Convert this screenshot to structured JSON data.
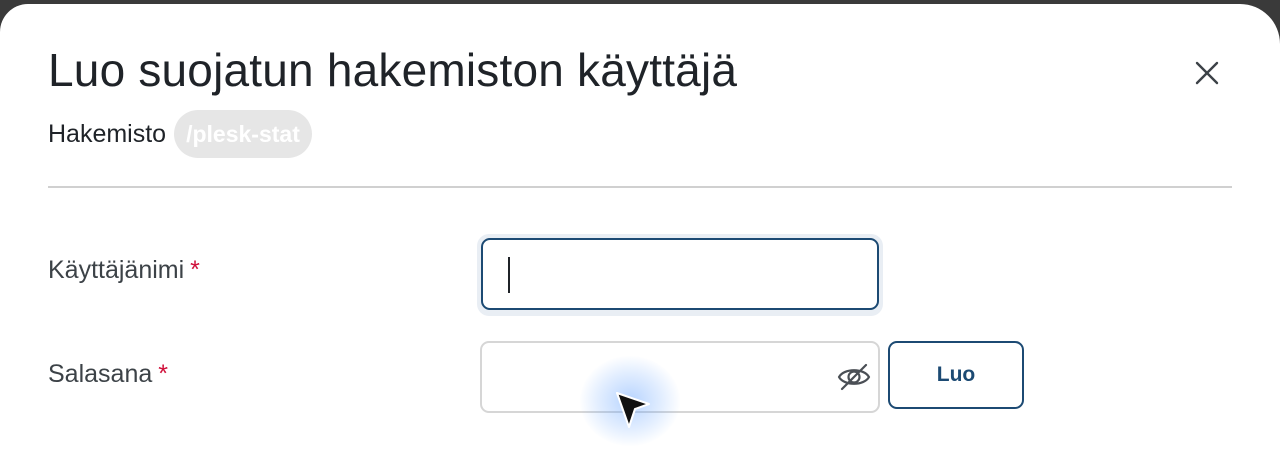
{
  "dialog": {
    "title": "Luo suojatun hakemiston käyttäjä",
    "directory_label": "Hakemisto",
    "directory_value": "/plesk-stat"
  },
  "form": {
    "username_label": "Käyttäjänimi",
    "username_value": "",
    "password_label": "Salasana",
    "password_value": "",
    "required_marker": "*",
    "generate_button_label": "Luo"
  },
  "icons": {
    "close": "close-icon",
    "password_visibility": "eye-off-icon",
    "pointer": "mouse-pointer-icon"
  },
  "colors": {
    "accent": "#1c4a73",
    "required": "#d0103a",
    "badge_bg": "#e6e6e6"
  }
}
